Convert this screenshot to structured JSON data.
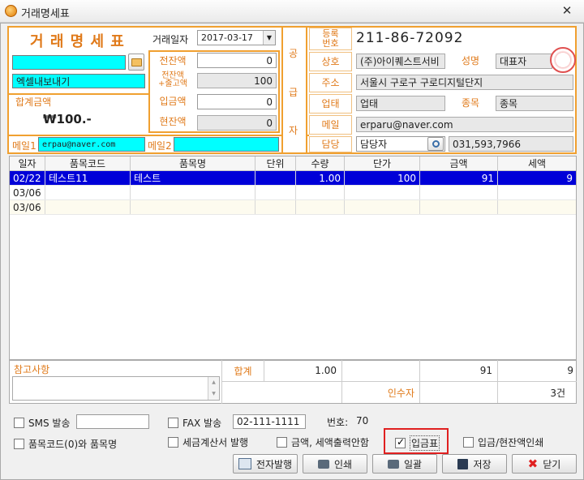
{
  "window": {
    "title": "거래명세표",
    "close_glyph": "✕"
  },
  "header": {
    "doc_title": "거 래 명 세 표",
    "date_label": "거래일자",
    "date_value": "2017-03-17",
    "customer_name": "",
    "customer_name2": "엑셀내보내기",
    "total_label": "합계금액",
    "total_value": "₩100.-",
    "prev_balance_label": "전잔액",
    "prev_balance": "0",
    "prev_plus_label_1": "전잔액",
    "prev_plus_label_2": "+출고액",
    "prev_plus_value": "100",
    "deposit_label": "입금액",
    "deposit_value": "0",
    "current_balance_label": "현잔액",
    "current_balance": "0",
    "mail1_label": "메일1",
    "mail1_value": "erpau@naver.com",
    "mail2_label": "메일2",
    "mail2_value": ""
  },
  "supplier": {
    "side_label": [
      "공",
      "급",
      "자"
    ],
    "reg_label_1": "등록",
    "reg_label_2": "번호",
    "reg_value": "211-86-72092",
    "company_label": "상호",
    "company_value": "(주)아이퀘스트서비",
    "ceo_label": "성명",
    "ceo_value": "대표자",
    "address_label": "주소",
    "address_value": "서울시 구로구 구로디지털단지",
    "biz_type_label": "업태",
    "biz_type_value": "업태",
    "biz_item_label": "종목",
    "biz_item_value": "종목",
    "email_label": "메일",
    "email_value": "erparu@naver.com",
    "manager_label": "담당",
    "manager_value": "담당자",
    "phone_value": "031,593,7966"
  },
  "grid": {
    "columns": [
      "일자",
      "품목코드",
      "품목명",
      "단위",
      "수량",
      "단가",
      "금액",
      "세액"
    ],
    "rows": [
      {
        "date": "02/22",
        "code": "테스트11",
        "name": "테스트",
        "unit": "",
        "qty": "1.00",
        "price": "100",
        "amount": "91",
        "tax": "9"
      },
      {
        "date": "03/06",
        "code": "",
        "name": "",
        "unit": "",
        "qty": "",
        "price": "",
        "amount": "",
        "tax": ""
      },
      {
        "date": "03/06",
        "code": "",
        "name": "",
        "unit": "",
        "qty": "",
        "price": "",
        "amount": "",
        "tax": ""
      }
    ]
  },
  "footer": {
    "memo_label": "참고사항",
    "sum_label": "합계",
    "sum_qty": "1.00",
    "sum_amount": "91",
    "sum_tax": "9",
    "receiver_label": "인수자",
    "count_value": "3건"
  },
  "options": {
    "sms_label": "SMS 발송",
    "sms_value": "",
    "fax_label": "FAX 발송",
    "fax_value": "02-111-1111",
    "number_label": "번호:",
    "number_value": "70",
    "item_code_label": "품목코드(0)와 품목명",
    "tax_invoice_label": "세금계산서 발행",
    "no_amount_label": "금액, 세액출력안함",
    "deposit_slip_label": "입금표",
    "deposit_balance_print_label": "입금/현잔액인쇄",
    "deposit_slip_checked": true
  },
  "buttons": {
    "e_issue": "전자발행",
    "print": "인쇄",
    "batch": "일괄",
    "save": "저장",
    "close": "닫기"
  },
  "colors": {
    "accent": "#f0a030",
    "selection": "#0000d8",
    "cyan": "#00ffff",
    "highlight_border": "#e02020"
  }
}
